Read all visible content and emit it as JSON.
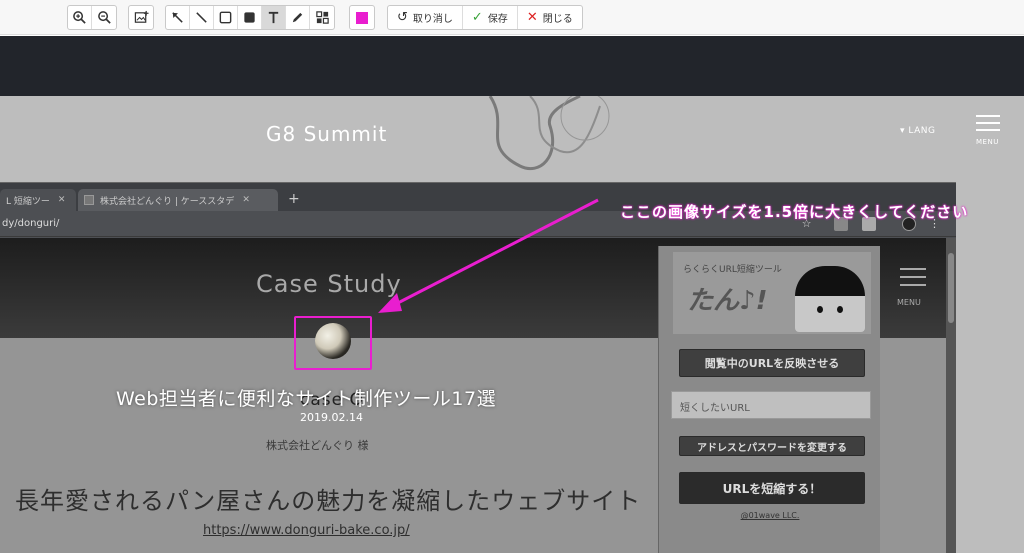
{
  "toolbar": {
    "undo_label": "取り消し",
    "save_label": "保存",
    "close_label": "閉じる",
    "color": "#e91ecf"
  },
  "site": {
    "title": "G8 Summit",
    "lang": "▾ LANG",
    "menu": "MENU"
  },
  "browser": {
    "tabs": [
      {
        "label": "L 短縮ツー"
      },
      {
        "label": "株式会社どんぐり | ケーススタデ"
      }
    ],
    "url": "dy/donguri/"
  },
  "page": {
    "hero": "Case Study",
    "menu": "MENU",
    "case": "case O",
    "date": "2019.02.14",
    "client": "株式会社どんぐり 様",
    "headline": "長年愛されるパン屋さんの魅力を凝縮したウェブサイト",
    "link": "https://www.donguri-bake.co.jp/"
  },
  "extension": {
    "banner_text": "らくらくURL短縮ツール",
    "logo": "たん♪!",
    "reflect_button": "閲覧中のURLを反映させる",
    "input_placeholder": "短くしたいURL",
    "change_button": "アドレスとパスワードを変更する",
    "shorten_button": "URLを短縮する！",
    "footer": "@01wave LLC."
  },
  "annotations": {
    "instruction": "ここの画像サイズを1.5倍に大きくしてください",
    "title": "Web担当者に便利なサイト制作ツール17選",
    "color": "#e91ecf"
  }
}
